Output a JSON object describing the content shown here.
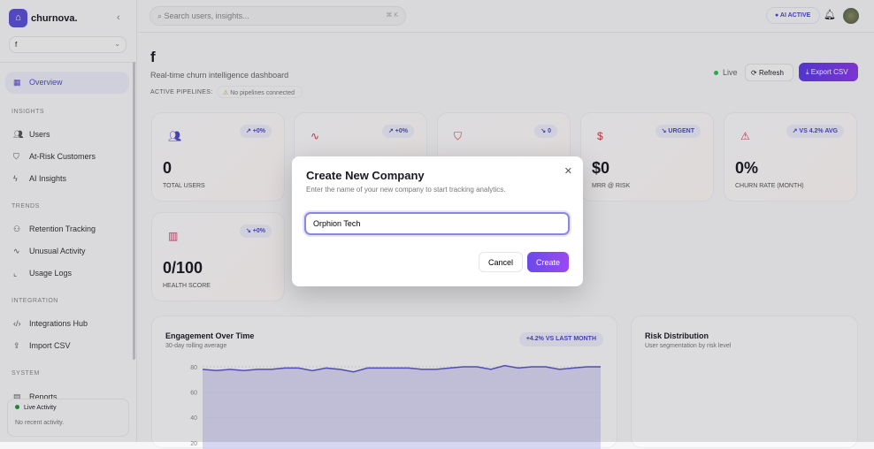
{
  "sidebar": {
    "brand": "churnova.",
    "workspace": "f",
    "items": [
      {
        "label": "Overview",
        "icon": "grid-icon"
      },
      {
        "section": "INSIGHTS"
      },
      {
        "label": "Users",
        "icon": "users-icon"
      },
      {
        "label": "At-Risk Customers",
        "icon": "shield-icon"
      },
      {
        "label": "AI Insights",
        "icon": "zap-icon"
      },
      {
        "section": "TRENDS"
      },
      {
        "label": "Retention Tracking",
        "icon": "user-check-icon"
      },
      {
        "label": "Unusual Activity",
        "icon": "activity-icon"
      },
      {
        "label": "Usage Logs",
        "icon": "line-chart-icon"
      },
      {
        "section": "INTEGRATION"
      },
      {
        "label": "Integrations Hub",
        "icon": "code-icon"
      },
      {
        "label": "Import CSV",
        "icon": "upload-icon"
      },
      {
        "section": "SYSTEM"
      },
      {
        "label": "Reports",
        "icon": "file-icon"
      }
    ],
    "live_activity": {
      "title": "Live Activity",
      "empty": "No recent activity."
    }
  },
  "header": {
    "search_placeholder": "Search users, insights...",
    "shortcut": "⌘ K",
    "ai_status": "AI ACTIVE"
  },
  "page": {
    "title": "f",
    "subtitle": "Real-time churn intelligence dashboard",
    "pipelines_label": "ACTIVE PIPELINES:",
    "pipelines_value": "No pipelines connected",
    "live": "Live",
    "refresh": "Refresh",
    "export": "Export CSV"
  },
  "stats": [
    {
      "icon": "users-icon",
      "badge": "↗ +0%",
      "value": "0",
      "label": "TOTAL USERS",
      "color": "#5048c8"
    },
    {
      "icon": "activity-icon",
      "badge": "↗ +0%",
      "value": "",
      "label": "",
      "color": "#d03a4a"
    },
    {
      "icon": "shield-icon",
      "badge": "↘ 0",
      "value": "",
      "label": "",
      "color": "#d03a4a"
    },
    {
      "icon": "dollar-icon",
      "badge": "↘ URGENT",
      "value": "$0",
      "label": "MRR @ RISK",
      "color": "#d03a4a"
    },
    {
      "icon": "alert-triangle-icon",
      "badge": "↗ VS 4.2% AVG",
      "value": "0%",
      "label": "CHURN RATE (MONTH)",
      "color": "#d03a5a"
    },
    {
      "icon": "bar-chart-icon",
      "badge": "↘ +0%",
      "value": "0/100",
      "label": "HEALTH SCORE",
      "color": "#d03a6a"
    }
  ],
  "engagement": {
    "title": "Engagement Over Time",
    "subtitle": "30-day rolling average",
    "badge": "+4.2% VS LAST MONTH"
  },
  "risk": {
    "title": "Risk Distribution",
    "subtitle": "User segmentation by risk level"
  },
  "chart_data": {
    "type": "area",
    "title": "Engagement Over Time",
    "y_ticks": [
      80,
      60,
      40,
      20
    ],
    "ylim": [
      0,
      82
    ],
    "values": [
      78,
      77,
      78,
      77,
      78,
      78,
      79,
      79,
      77,
      79,
      78,
      76,
      79,
      79,
      79,
      79,
      78,
      78,
      79,
      80,
      80,
      78,
      81,
      79,
      80,
      80,
      78,
      79,
      80,
      80
    ],
    "color": "#5a56c8"
  },
  "modal": {
    "title": "Create New Company",
    "description": "Enter the name of your new company to start tracking analytics.",
    "input_value": "Orphion Tech",
    "cancel": "Cancel",
    "create": "Create",
    "close": "✕"
  }
}
